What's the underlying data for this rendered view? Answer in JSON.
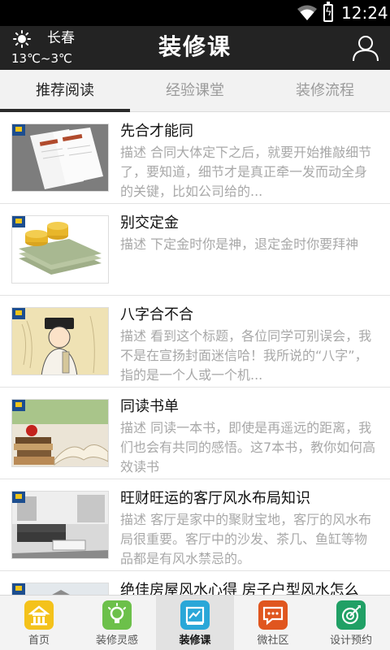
{
  "status_bar": {
    "time": "12:24"
  },
  "header": {
    "city": "长春",
    "temperature": "13℃~3℃",
    "title": "装修课"
  },
  "tabs": [
    {
      "label": "推荐阅读",
      "active": true
    },
    {
      "label": "经验课堂",
      "active": false
    },
    {
      "label": "装修流程",
      "active": false
    }
  ],
  "articles": [
    {
      "title": "先合才能同",
      "desc": "描述 合同大体定下之后，就要开始推敲细节了，要知道，细节才是真正牵一发而动全身的关键，比如公司给的...",
      "thumb": "documents"
    },
    {
      "title": "别交定金",
      "desc": "描述 下定金时你是神，退定金时你要拜神",
      "thumb": "money"
    },
    {
      "title": "八字合不合",
      "desc": "描述 看到这个标题，各位同学可别误会，我不是在宣扬封面迷信哈！我所说的“八字”，指的是一个人或一个机...",
      "thumb": "scholar"
    },
    {
      "title": "同读书单",
      "desc": "描述 同读一本书，即使是再遥远的距离，我们也会有共同的感悟。这7本书，教你如何高效读书",
      "thumb": "books"
    },
    {
      "title": "旺财旺运的客厅风水布局知识",
      "desc": "描述 客厅是家中的聚财宝地，客厅的风水布局很重要。客厅中的沙发、茶几、鱼缸等物品都是有风水禁忌的。",
      "thumb": "livingroom"
    },
    {
      "title": "绝佳房屋风水心得 房子户型风水怎么",
      "desc": "",
      "thumb": "house"
    }
  ],
  "bottom_nav": [
    {
      "label": "首页",
      "icon": "home-icon",
      "color": "#f4c21b",
      "active": false
    },
    {
      "label": "装修灵感",
      "icon": "bulb-icon",
      "color": "#6cc04a",
      "active": false
    },
    {
      "label": "装修课",
      "icon": "course-icon",
      "color": "#2aa7d8",
      "active": true
    },
    {
      "label": "微社区",
      "icon": "chat-icon",
      "color": "#e0561f",
      "active": false
    },
    {
      "label": "设计预约",
      "icon": "target-icon",
      "color": "#20a065",
      "active": false
    }
  ]
}
